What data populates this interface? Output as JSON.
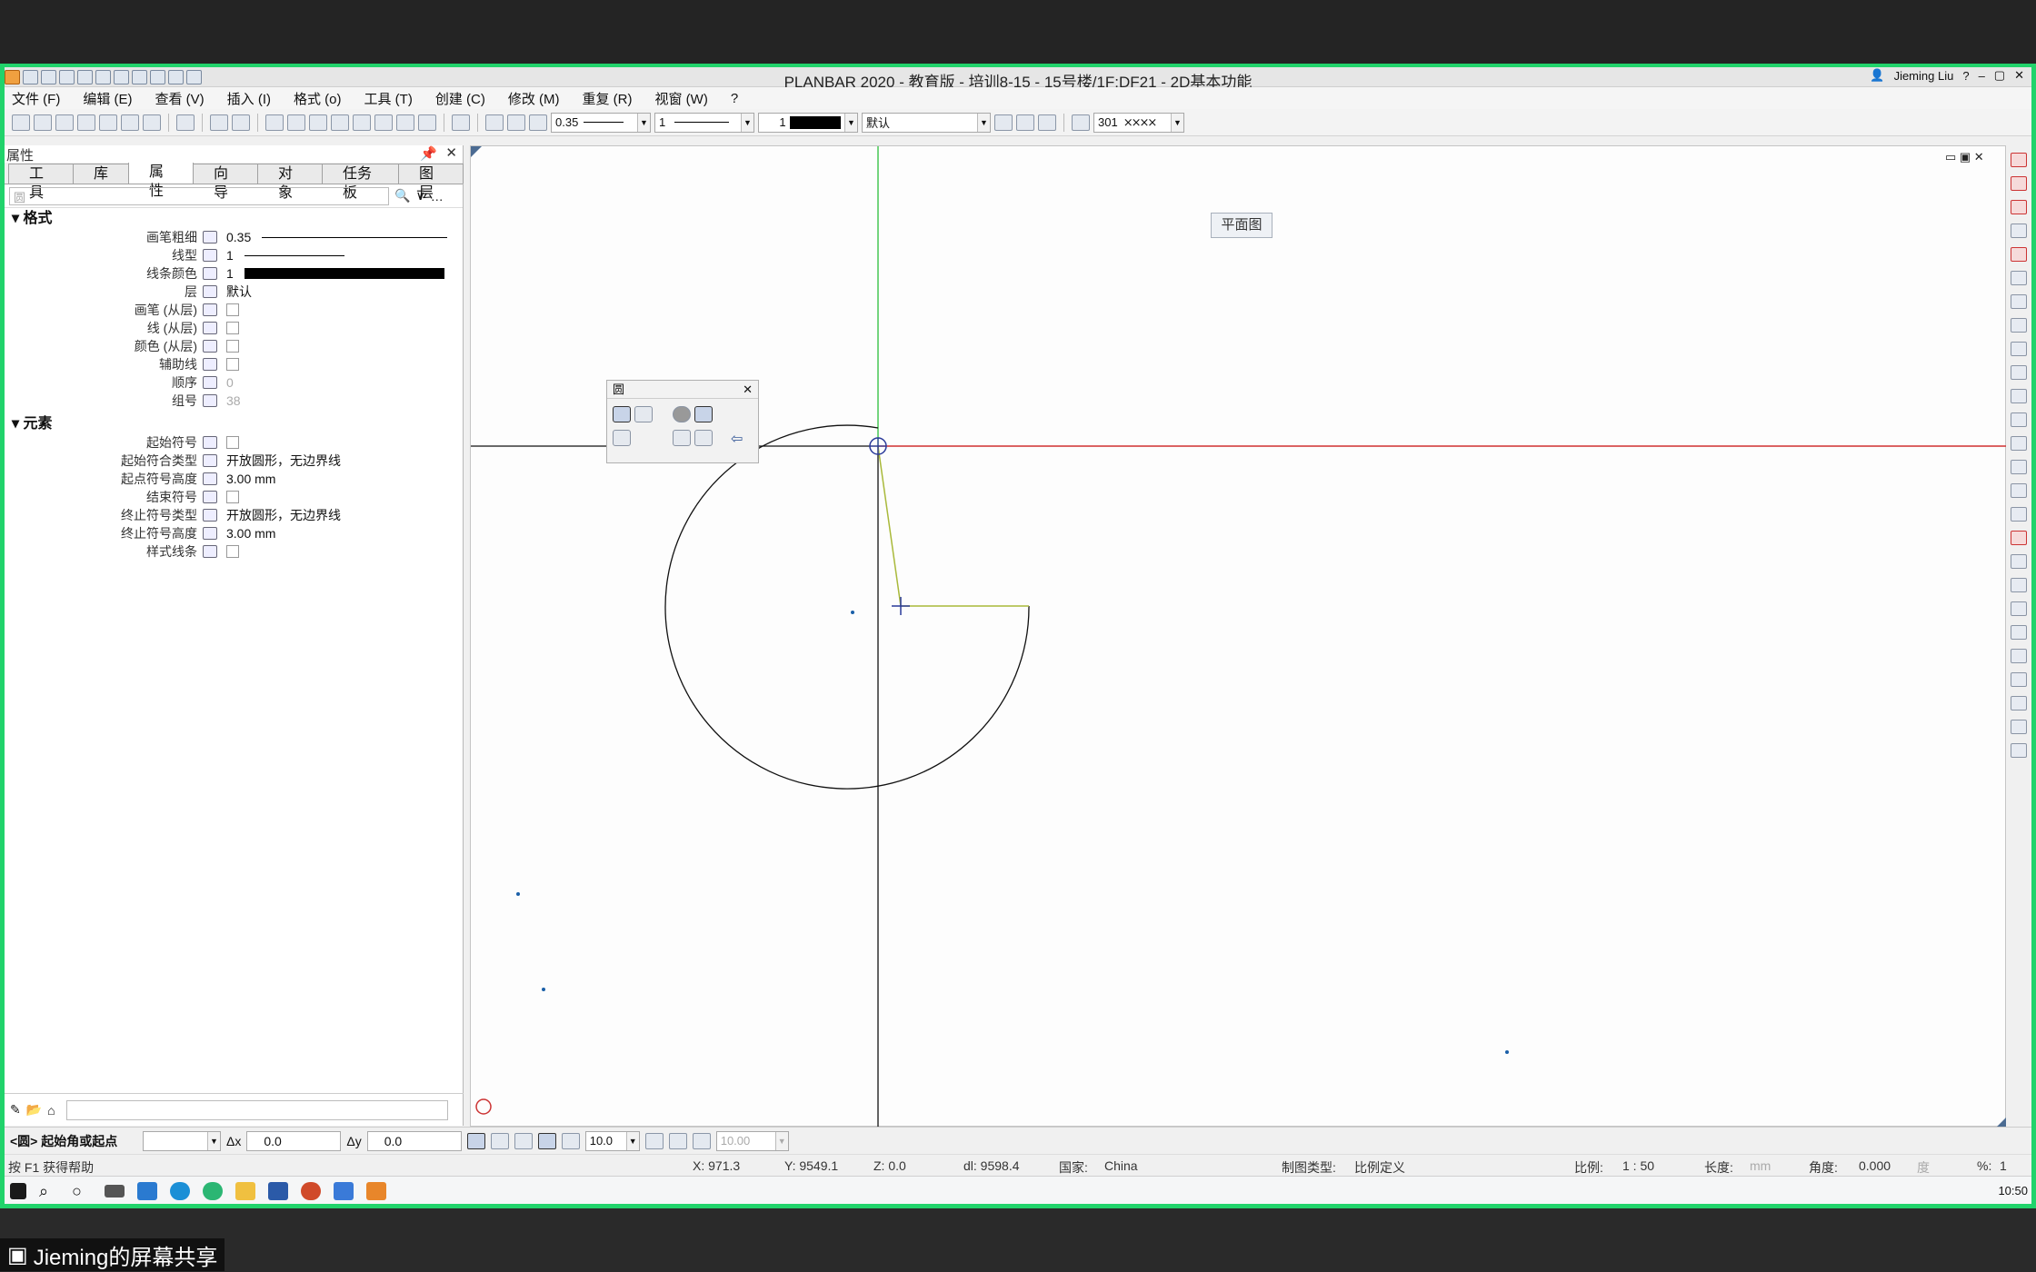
{
  "app": {
    "title": "PLANBAR 2020 - 教育版 - 培训8-15 - 15号楼/1F:DF21 - 2D基本功能",
    "user": "Jieming Liu"
  },
  "menu": [
    "文件 (F)",
    "编辑 (E)",
    "查看 (V)",
    "插入 (I)",
    "格式 (o)",
    "工具 (T)",
    "创建 (C)",
    "修改 (M)",
    "重复 (R)",
    "视窗 (W)",
    "?"
  ],
  "toolbar": {
    "pen": "0.35",
    "line": "1",
    "color": "1",
    "layer": "默认",
    "hatch": "301"
  },
  "panel": {
    "title": "属性",
    "tabs": [
      "工具",
      "库",
      "属性",
      "向导",
      "对象",
      "任务板",
      "图层"
    ],
    "active_tab": "属性",
    "search_placeholder": "圆",
    "format_title": "格式",
    "format": [
      {
        "label": "画笔粗细",
        "value": "0.35"
      },
      {
        "label": "线型",
        "value": "1"
      },
      {
        "label": "线条颜色",
        "value": "1"
      },
      {
        "label": "层",
        "value": "默认"
      },
      {
        "label": "画笔 (从层)",
        "value": ""
      },
      {
        "label": "线 (从层)",
        "value": ""
      },
      {
        "label": "颜色 (从层)",
        "value": ""
      },
      {
        "label": "辅助线",
        "value": ""
      },
      {
        "label": "顺序",
        "value": "0"
      },
      {
        "label": "组号",
        "value": "38"
      }
    ],
    "element_title": "元素",
    "element": [
      {
        "label": "起始符号",
        "value": ""
      },
      {
        "label": "起始符合类型",
        "value": "开放圆形，无边界线"
      },
      {
        "label": "起点符号高度",
        "value": "3.00 mm"
      },
      {
        "label": "结束符号",
        "value": ""
      },
      {
        "label": "终止符号类型",
        "value": "开放圆形，无边界线"
      },
      {
        "label": "终止符号高度",
        "value": "3.00 mm"
      },
      {
        "label": "样式线条",
        "value": ""
      }
    ]
  },
  "palette": {
    "title": "圆"
  },
  "view_label": "平面图",
  "input": {
    "prompt": "<圆> 起始角或起点",
    "dx_label": "Δx",
    "dx": "0.0",
    "dy_label": "Δy",
    "dy": "0.0",
    "snap": "10.0",
    "grid": "10.00"
  },
  "status": {
    "help": "按 F1 获得帮助",
    "x": "X:  971.3",
    "y": "Y:  9549.1",
    "z": "Z:  0.0",
    "dl": "dl:  9598.4",
    "country_label": "国家:",
    "country": "China",
    "drawing_type_label": "制图类型:",
    "drawing_type": "比例定义",
    "scale_label": "比例:",
    "scale": "1 : 50",
    "length_label": "长度:",
    "length_unit": "mm",
    "angle_label": "角度:",
    "angle": "0.000",
    "angle_unit": "度",
    "percent_label": "%:",
    "percent": "1"
  },
  "clock": "10:50",
  "share_label": "Jieming的屏幕共享"
}
